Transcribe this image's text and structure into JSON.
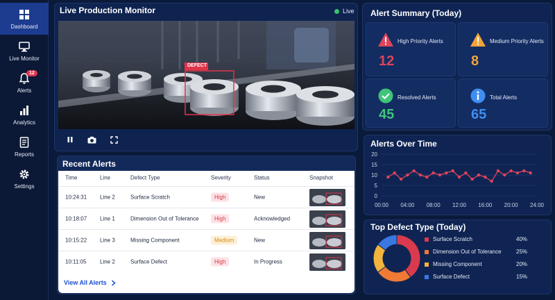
{
  "sidebar": {
    "items": [
      {
        "label": "Dashboard",
        "icon": "dashboard-icon"
      },
      {
        "label": "Live Monitor",
        "icon": "monitor-icon"
      },
      {
        "label": "Alerts",
        "icon": "bell-icon",
        "badge": "12"
      },
      {
        "label": "Analytics",
        "icon": "bar-chart-icon"
      },
      {
        "label": "Reports",
        "icon": "document-icon"
      },
      {
        "label": "Settings",
        "icon": "gear-icon"
      }
    ]
  },
  "monitor": {
    "title": "Live Production Monitor",
    "live_label": "Live",
    "defect_tag": "DEFECT"
  },
  "recent": {
    "title": "Recent Alerts",
    "columns": [
      "Time",
      "Line",
      "Defect Type",
      "Severity",
      "Status",
      "Snapshot"
    ],
    "rows": [
      {
        "time": "10:24:31",
        "line": "Line 2",
        "defect": "Surface Scratch",
        "severity": "High",
        "status": "New"
      },
      {
        "time": "10:18:07",
        "line": "Line 1",
        "defect": "Dimension Out of Tolerance",
        "severity": "High",
        "status": "Acknowledged"
      },
      {
        "time": "10:15:22",
        "line": "Line 3",
        "defect": "Missing Component",
        "severity": "Medium",
        "status": "New"
      },
      {
        "time": "10:11:05",
        "line": "Line 2",
        "defect": "Surface Defect",
        "severity": "High",
        "status": "In Progress"
      }
    ],
    "view_all": "View All Alerts"
  },
  "summary": {
    "title": "Alert Summary (Today)",
    "cards": [
      {
        "label": "High Priority Alerts",
        "value": "12",
        "color": "#e0445a",
        "icon": "warning-icon"
      },
      {
        "label": "Medium Priority Alerts",
        "value": "8",
        "color": "#f2a33a",
        "icon": "warning-icon"
      },
      {
        "label": "Resolved Alerts",
        "value": "45",
        "color": "#3fc47a",
        "icon": "check-circle-icon"
      },
      {
        "label": "Total Alerts",
        "value": "65",
        "color": "#3f8ef0",
        "icon": "info-circle-icon"
      }
    ]
  },
  "chart_data": [
    {
      "type": "line",
      "title": "Alerts Over Time",
      "x_ticks": [
        "00:00",
        "04:00",
        "08:00",
        "12:00",
        "16:00",
        "20:00",
        "24:00"
      ],
      "y_ticks": [
        0,
        5,
        10,
        15,
        20
      ],
      "ylim": [
        0,
        20
      ],
      "xlim": [
        0,
        24
      ],
      "x": [
        1,
        2,
        3,
        4,
        5,
        6,
        7,
        8,
        9,
        10,
        11,
        12,
        13,
        14,
        15,
        16,
        17,
        18,
        19,
        20,
        21,
        22,
        23
      ],
      "values": [
        9,
        11,
        8,
        10,
        12,
        10,
        9,
        11,
        10,
        11,
        12,
        9,
        11,
        8,
        10,
        9,
        7,
        12,
        10,
        12,
        11,
        12,
        11
      ],
      "color": "#e0445a",
      "grid": true
    },
    {
      "type": "pie",
      "title": "Top Defect Type (Today)",
      "categories": [
        "Surface Scratch",
        "Dimension Out of Tolerance",
        "Missing Component",
        "Surface Defect"
      ],
      "values": [
        40,
        25,
        20,
        15
      ],
      "labels": [
        "40%",
        "25%",
        "20%",
        "15%"
      ],
      "colors": [
        "#d93a4e",
        "#f07a35",
        "#f2b43c",
        "#3a78e0"
      ],
      "donut": true
    }
  ]
}
